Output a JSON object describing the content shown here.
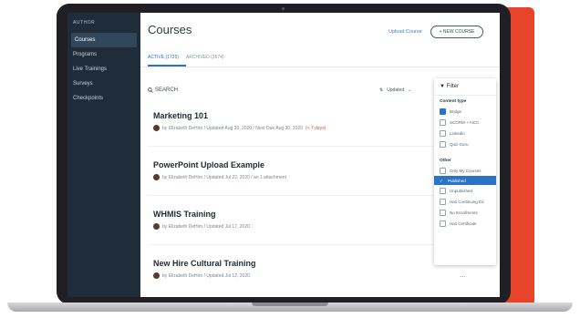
{
  "sidebar": {
    "author_label": "AUTHOR",
    "items": [
      {
        "label": "Courses"
      },
      {
        "label": "Programs"
      },
      {
        "label": "Live Trainings"
      },
      {
        "label": "Surveys"
      },
      {
        "label": "Checkpoints"
      }
    ]
  },
  "header": {
    "title": "Courses",
    "upload_link": "Upload Course",
    "new_button": "+ NEW COURSE"
  },
  "tabs": [
    {
      "label": "ACTIVE (1725)"
    },
    {
      "label": "ARCHIVED (3674)"
    }
  ],
  "search": {
    "label": "SEARCH"
  },
  "sort": {
    "label": "Updated"
  },
  "courses": [
    {
      "title": "Marketing 101",
      "meta": "by Elizabeth DeHiro / Updated Aug 30, 2020 / Next Due Aug 30, 2020",
      "overdue": "(< 7 days)"
    },
    {
      "title": "PowerPoint Upload Example",
      "meta": "by Elizabeth DeHiro / Updated Jul 22, 2020 / an 1 attachment",
      "overdue": ""
    },
    {
      "title": "WHMIS Training",
      "meta": "by Elizabeth DeHiro / Updated Jul 17, 2020",
      "overdue": ""
    },
    {
      "title": "New Hire Cultural Training",
      "meta": "by Elizabeth DeHiro / Updated Jul 12, 2020",
      "overdue": ""
    }
  ],
  "filter": {
    "title": "Filter",
    "content_type_label": "Content type",
    "content_types": [
      "Bridge",
      "SCORM + AICC",
      "Linkedin",
      "Quiz Guru"
    ],
    "other_label": "Other",
    "other": [
      "Only My Courses",
      "Published",
      "Unpublished",
      "Has Continuing Ed",
      "No Enrollments",
      "Has Certificate"
    ]
  },
  "colors": {
    "accent": "#e8432b",
    "sidebar": "#1f2d3a",
    "link": "#2a73c6"
  }
}
